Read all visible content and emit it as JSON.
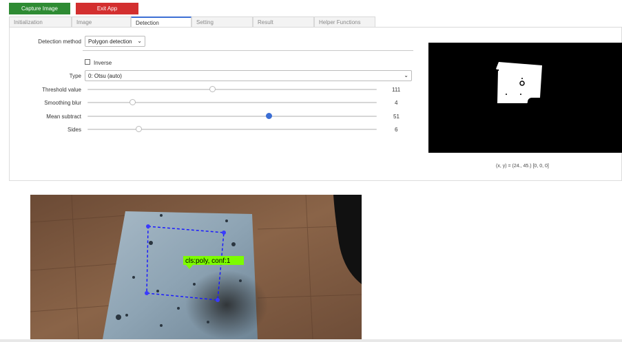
{
  "toolbar": {
    "capture_label": "Capture Image",
    "exit_label": "Exit App"
  },
  "tabs": [
    {
      "label": "Initialization",
      "active": false
    },
    {
      "label": "Image",
      "active": false
    },
    {
      "label": "Detection",
      "active": true
    },
    {
      "label": "Setting",
      "active": false
    },
    {
      "label": "Result",
      "active": false
    },
    {
      "label": "Helper Functions",
      "active": false
    }
  ],
  "detection": {
    "method_label": "Detection method",
    "method_value": "Polygon detection",
    "inverse_label": "Inverse",
    "inverse_checked": false,
    "type_label": "Type",
    "type_value": "0: Otsu (auto)",
    "sliders": [
      {
        "label": "Threshold value",
        "value": "111",
        "fraction": 0.43,
        "active": false
      },
      {
        "label": "Smoothing blur",
        "value": "4",
        "fraction": 0.155,
        "active": false
      },
      {
        "label": "Mean subtract",
        "value": "51",
        "fraction": 0.625,
        "active": true
      },
      {
        "label": "Sides",
        "value": "6",
        "fraction": 0.175,
        "active": false
      }
    ]
  },
  "preview": {
    "coords_text": "(x, y) = (24., 45.) [0, 0, 0]"
  },
  "camera": {
    "detection_label": "cls:poly, conf:1"
  },
  "colors": {
    "accent": "#3b6ed4",
    "capture": "#2e8b33",
    "exit": "#d32f2f",
    "detection_box": "#1a1aff",
    "detection_label_bg": "#7cfc00"
  }
}
